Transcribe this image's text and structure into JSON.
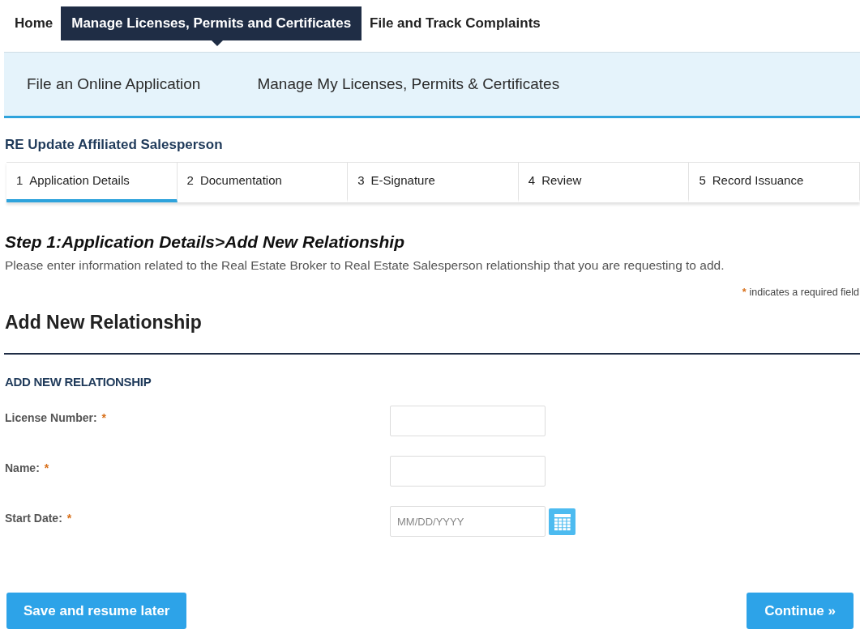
{
  "top_nav": [
    {
      "label": "Home",
      "selected": false
    },
    {
      "label": "Manage Licenses, Permits and Certificates",
      "selected": true
    },
    {
      "label": "File and Track Complaints",
      "selected": false
    }
  ],
  "sub_nav": [
    {
      "label": "File an Online Application"
    },
    {
      "label": "Manage My Licenses, Permits & Certificates"
    }
  ],
  "record_title": "RE Update Affiliated Salesperson",
  "steps": [
    {
      "number": "1",
      "label": "Application Details",
      "selected": true
    },
    {
      "number": "2",
      "label": "Documentation",
      "selected": false
    },
    {
      "number": "3",
      "label": "E-Signature",
      "selected": false
    },
    {
      "number": "4",
      "label": "Review",
      "selected": false
    },
    {
      "number": "5",
      "label": "Record Issuance",
      "selected": false
    }
  ],
  "step_heading": "Step 1:Application Details>Add New Relationship",
  "description": "Please enter information related to the Real Estate Broker to Real Estate Salesperson relationship that you are requesting to add.",
  "required_note": {
    "mark": "*",
    "text": "indicates a required field"
  },
  "section_title": "Add New Relationship",
  "subsection_title": "ADD NEW RELATIONSHIP",
  "fields": [
    {
      "kind": "text",
      "label": "License Number:",
      "required_mark": "*"
    },
    {
      "kind": "text",
      "label": "Name:",
      "required_mark": "*"
    },
    {
      "kind": "date",
      "label": "Start Date:",
      "required_mark": "*",
      "placeholder": "MM/DD/YYYY"
    }
  ],
  "buttons": [
    {
      "kind": "secondary",
      "label": "Save and resume later"
    },
    {
      "kind": "primary",
      "label": "Continue »"
    }
  ]
}
